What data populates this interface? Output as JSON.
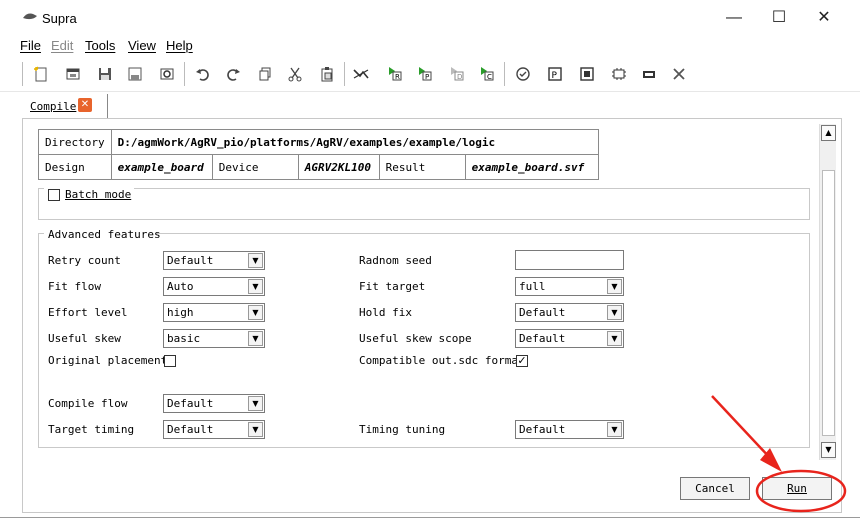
{
  "window": {
    "title": "Supra",
    "minimize_glyph": "—",
    "maximize_glyph": "☐",
    "close_glyph": "✕"
  },
  "menubar": {
    "items": [
      {
        "label": "File",
        "hotkey": "F"
      },
      {
        "label": "Edit",
        "hotkey": "E",
        "disabled": true
      },
      {
        "label": "Tools",
        "hotkey": "T"
      },
      {
        "label": "View",
        "hotkey": "V"
      },
      {
        "label": "Help",
        "hotkey": "H"
      }
    ]
  },
  "toolbar": {
    "icons": [
      "new-file-icon",
      "open-project-icon",
      "save-icon",
      "save-as-icon",
      "settings-icon",
      "undo-icon",
      "redo-icon",
      "copy-icon",
      "cut-icon",
      "paste-icon",
      "synthesis-icon",
      "run-r-icon",
      "run-p-icon",
      "run-d-icon",
      "run-c-icon",
      "check-icon",
      "program-icon",
      "chip-icon",
      "debug-icon",
      "memory-icon",
      "stop-icon"
    ]
  },
  "tab": {
    "label": "Compile",
    "close_glyph": "✕"
  },
  "info": {
    "directory_label": "Directory",
    "directory_value": "D:/agmWork/AgRV_pio/platforms/AgRV/examples/example/logic",
    "design_label": "Design",
    "design_value": "example_board",
    "device_label": "Device",
    "device_value": "AGRV2KL100",
    "result_label": "Result",
    "result_value": "example_board.svf"
  },
  "batch": {
    "label": "Batch mode",
    "checked": false
  },
  "advanced": {
    "title": "Advanced features",
    "retry_count": {
      "label": "Retry count",
      "value": "Default"
    },
    "fit_flow": {
      "label": "Fit flow",
      "value": "Auto"
    },
    "effort_level": {
      "label": "Effort level",
      "value": "high"
    },
    "useful_skew": {
      "label": "Useful skew",
      "value": "basic"
    },
    "original_placement": {
      "label": "Original placement",
      "checked": false
    },
    "random_seed": {
      "label": "Radnom seed",
      "value": ""
    },
    "fit_target": {
      "label": "Fit target",
      "value": "full"
    },
    "hold_fix": {
      "label": "Hold fix",
      "value": "Default"
    },
    "useful_skew_scope": {
      "label": "Useful skew scope",
      "value": "Default"
    },
    "compatible_sdc": {
      "label": "Compatible out.sdc format",
      "checked": true,
      "glyph": "✓"
    },
    "compile_flow": {
      "label": "Compile flow",
      "value": "Default"
    },
    "target_timing": {
      "label": "Target timing",
      "value": "Default"
    },
    "timing_tuning": {
      "label": "Timing tuning",
      "value": "Default"
    }
  },
  "buttons": {
    "cancel": "Cancel",
    "run": "Run"
  },
  "colors": {
    "annotation_red": "#e8241c",
    "tab_close": "#e8642c"
  }
}
